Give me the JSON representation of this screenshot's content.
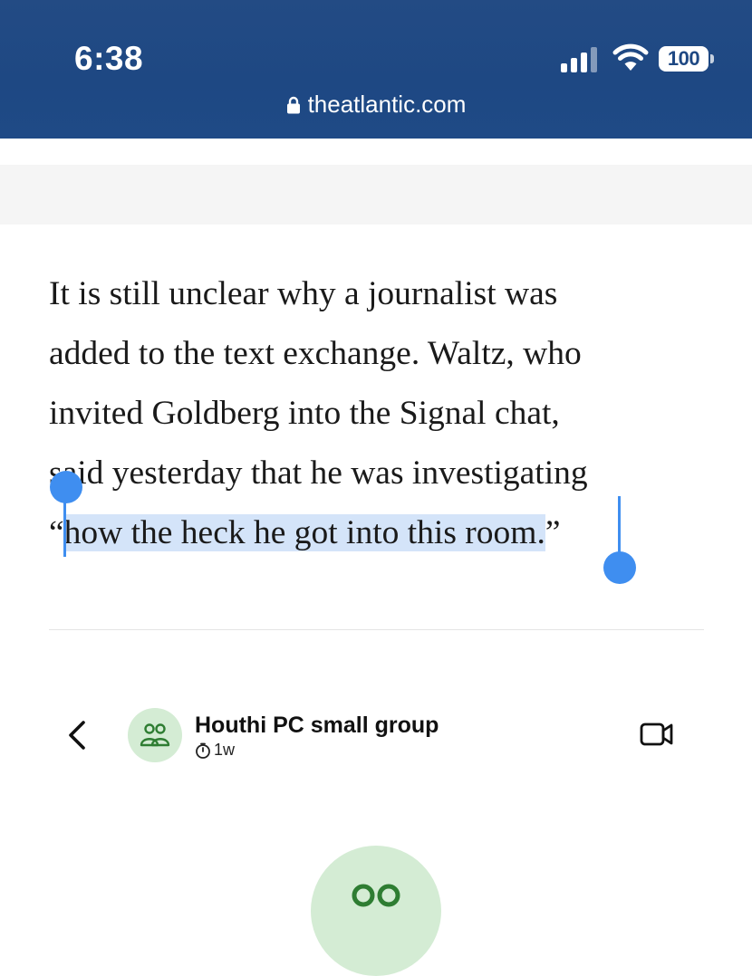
{
  "status_bar": {
    "time": "6:38",
    "battery": "100"
  },
  "browser": {
    "url": "theatlantic.com"
  },
  "article": {
    "lines": [
      "It is still unclear why a journalist was",
      "added to the text exchange. Waltz, who",
      "invited Goldberg into the Signal chat,",
      "said yesterday that he was investigating"
    ],
    "last_line_open_quote": "“",
    "selected_text": "how the heck he got into this room.",
    "last_line_close_quote": "”"
  },
  "embedded_chat": {
    "group_name": "Houthi PC small group",
    "disappearing_timer": "1w"
  },
  "colors": {
    "top_bar": "#1e4883",
    "selection_highlight": "#d4e4f9",
    "selection_handle": "#3f8ef0",
    "avatar_bg": "#d4ecd4",
    "avatar_icon": "#2e7d32"
  },
  "icons": [
    "lock-icon",
    "cellular-signal-icon",
    "wifi-icon",
    "battery-icon",
    "back-chevron-icon",
    "group-icon",
    "timer-icon",
    "video-call-icon"
  ]
}
